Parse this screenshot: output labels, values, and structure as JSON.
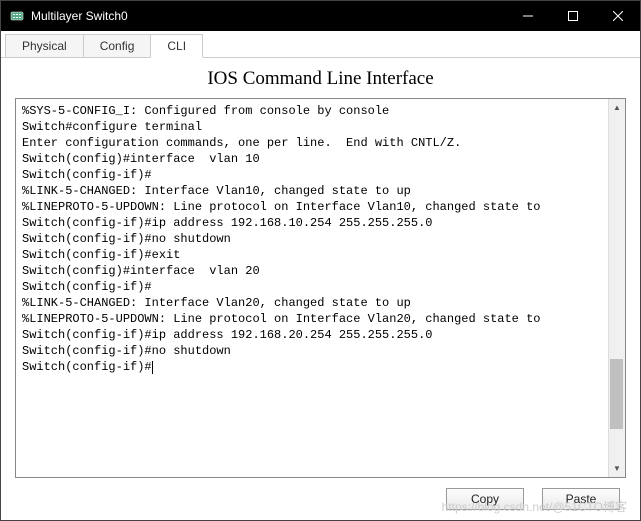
{
  "window": {
    "title": "Multilayer Switch0"
  },
  "tabs": [
    {
      "label": "Physical",
      "active": false
    },
    {
      "label": "Config",
      "active": false
    },
    {
      "label": "CLI",
      "active": true
    }
  ],
  "cli": {
    "title": "IOS Command Line Interface",
    "lines": [
      "%SYS-5-CONFIG_I: Configured from console by console",
      "",
      "Switch#configure terminal",
      "Enter configuration commands, one per line.  End with CNTL/Z.",
      "Switch(config)#interface  vlan 10",
      "Switch(config-if)#",
      "%LINK-5-CHANGED: Interface Vlan10, changed state to up",
      "",
      "%LINEPROTO-5-UPDOWN: Line protocol on Interface Vlan10, changed state to ",
      "",
      "Switch(config-if)#ip address 192.168.10.254 255.255.255.0",
      "Switch(config-if)#no shutdown",
      "Switch(config-if)#exit",
      "Switch(config)#interface  vlan 20",
      "Switch(config-if)#",
      "%LINK-5-CHANGED: Interface Vlan20, changed state to up",
      "",
      "%LINEPROTO-5-UPDOWN: Line protocol on Interface Vlan20, changed state to ",
      "",
      "Switch(config-if)#ip address 192.168.20.254 255.255.255.0",
      "Switch(config-if)#no shutdown",
      "Switch(config-if)#"
    ]
  },
  "buttons": {
    "copy": "Copy",
    "paste": "Paste"
  },
  "watermark": "https://blog.csdn.net/@51CTO博客"
}
